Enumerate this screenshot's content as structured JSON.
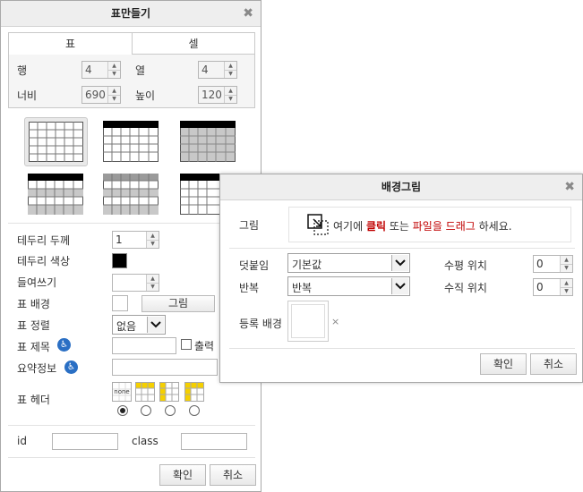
{
  "table_dialog": {
    "title": "표만들기",
    "tabs": [
      "표",
      "셀"
    ],
    "rows_label": "행",
    "rows_value": "4",
    "cols_label": "열",
    "cols_value": "4",
    "width_label": "너비",
    "width_value": "690",
    "height_label": "높이",
    "height_value": "120",
    "border_width_label": "테두리 두께",
    "border_width_value": "1",
    "border_color_label": "테두리 색상",
    "border_color": "#000000",
    "indent_label": "들여쓰기",
    "bg_label": "표 배경",
    "image_button": "그림",
    "align_label": "표 정렬",
    "align_value": "없음",
    "caption_label": "표 제목",
    "print_label": "출력",
    "summary_label": "요약정보",
    "header_label": "표 헤더",
    "header_none_text": "none",
    "id_label": "id",
    "class_label": "class",
    "ok": "확인",
    "cancel": "취소"
  },
  "bg_dialog": {
    "title": "배경그림",
    "image_label": "그림",
    "drop_prefix": "여기에 ",
    "drop_click": "클릭",
    "drop_middle": " 또는 ",
    "drop_drag": "파일을 드래그",
    "drop_suffix": " 하세요.",
    "attach_label": "덧붙임",
    "attach_value": "기본값",
    "repeat_label": "반복",
    "repeat_value": "반복",
    "hpos_label": "수평 위치",
    "hpos_value": "0",
    "vpos_label": "수직 위치",
    "vpos_value": "0",
    "registered_label": "등록 배경",
    "remove_glyph": "×",
    "ok": "확인",
    "cancel": "취소"
  },
  "colors": {
    "accent_red": "#c00000",
    "accessibility_blue": "#2a6fc4"
  }
}
